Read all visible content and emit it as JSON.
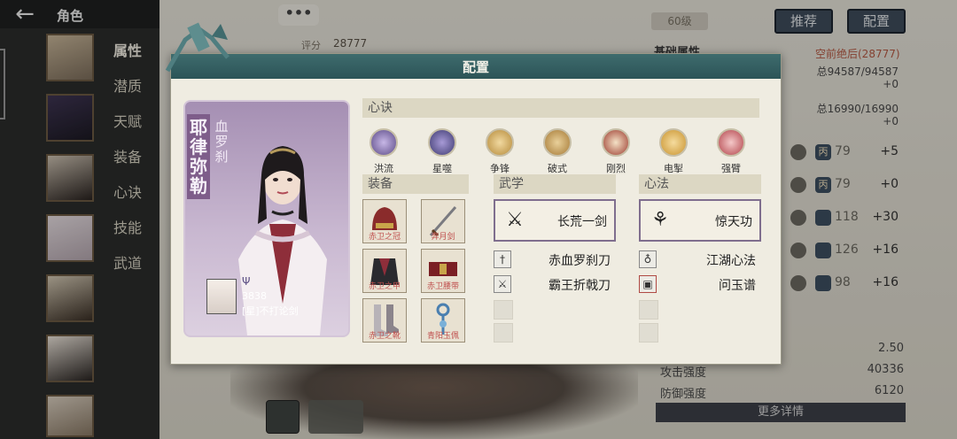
{
  "header": {
    "title": "角色"
  },
  "sidebar": {
    "tabs": [
      "属性",
      "潜质",
      "天赋",
      "装备",
      "心诀",
      "技能",
      "武道"
    ]
  },
  "background": {
    "chat": "•••",
    "score_label": "评分",
    "score_value": "28777",
    "level_badge": "60级",
    "buttons": {
      "recommend": "推荐",
      "config": "配置"
    },
    "basic_attr": {
      "title": "基础属性",
      "subtitle": "空前绝后(28777)"
    },
    "pools": [
      {
        "value": "总94587/94587",
        "plus": "+0"
      },
      {
        "value": "总16990/16990",
        "plus": "+0"
      }
    ],
    "attr_rows": [
      {
        "grade": "丙",
        "value": "79",
        "plus": "+5"
      },
      {
        "grade": "丙",
        "value": "79",
        "plus": "+0"
      },
      {
        "grade": "",
        "value": "118",
        "plus": "+30"
      },
      {
        "grade": "",
        "value": "126",
        "plus": "+16"
      },
      {
        "grade": "",
        "value": "98",
        "plus": "+16"
      }
    ],
    "bottom_stats": [
      {
        "label": "",
        "value": "2.50"
      },
      {
        "label": "攻击强度",
        "value": "40336"
      },
      {
        "label": "防御强度",
        "value": "6120"
      }
    ],
    "more_detail": "更多详情"
  },
  "modal": {
    "title": "配置",
    "card": {
      "name": "耶律弥勒",
      "title": "血罗刹",
      "power": "3838",
      "tag": "[星]不打论剑"
    },
    "xinjue": {
      "title": "心诀",
      "skills": [
        {
          "name": "洪流",
          "color": "#5b4a86"
        },
        {
          "name": "星噬",
          "color": "#3e3a70"
        },
        {
          "name": "争锋",
          "color": "#b58a3a"
        },
        {
          "name": "破式",
          "color": "#a57935"
        },
        {
          "name": "刚烈",
          "color": "#9c3a2e"
        },
        {
          "name": "电掣",
          "color": "#c9932f"
        },
        {
          "name": "强臂",
          "color": "#b2434a"
        }
      ]
    },
    "equip": {
      "title": "装备",
      "slots": [
        "赤卫之冠",
        "奔月剑",
        "赤卫之甲",
        "赤卫腰带",
        "赤卫之靴",
        "青阳玉佩"
      ]
    },
    "wuxue": {
      "title": "武学",
      "main": "长荒一剑",
      "subs": [
        "赤血罗刹刀",
        "霸王折戟刀"
      ]
    },
    "xinfa": {
      "title": "心法",
      "main": "惊天功",
      "subs": [
        "江湖心法",
        "问玉谱"
      ]
    }
  }
}
